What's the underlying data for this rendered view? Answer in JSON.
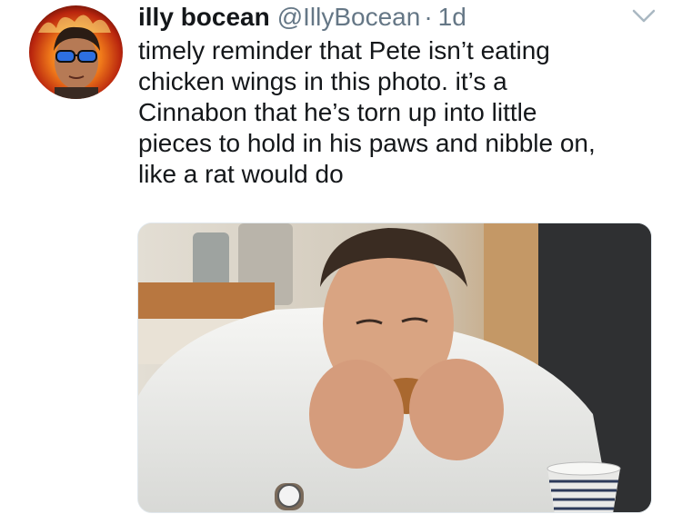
{
  "tweet": {
    "author": {
      "display_name": "illy bocean",
      "handle": "@IllyBocean",
      "avatar_icon": "profile-avatar-icon"
    },
    "separator": "·",
    "timestamp": "1d",
    "menu_icon": "chevron-down-icon",
    "text": "timely reminder that Pete isn’t eating\nchicken wings in this photo. it’s a\nCinnabon that he’s torn up into little\npieces to hold in his paws and nibble on,\nlike a rat would do",
    "media": {
      "type": "photo",
      "icon": "photo-icon"
    }
  },
  "colors": {
    "text_primary": "#14171a",
    "text_secondary": "#657786",
    "background": "#ffffff",
    "caret": "#aab8c2"
  }
}
